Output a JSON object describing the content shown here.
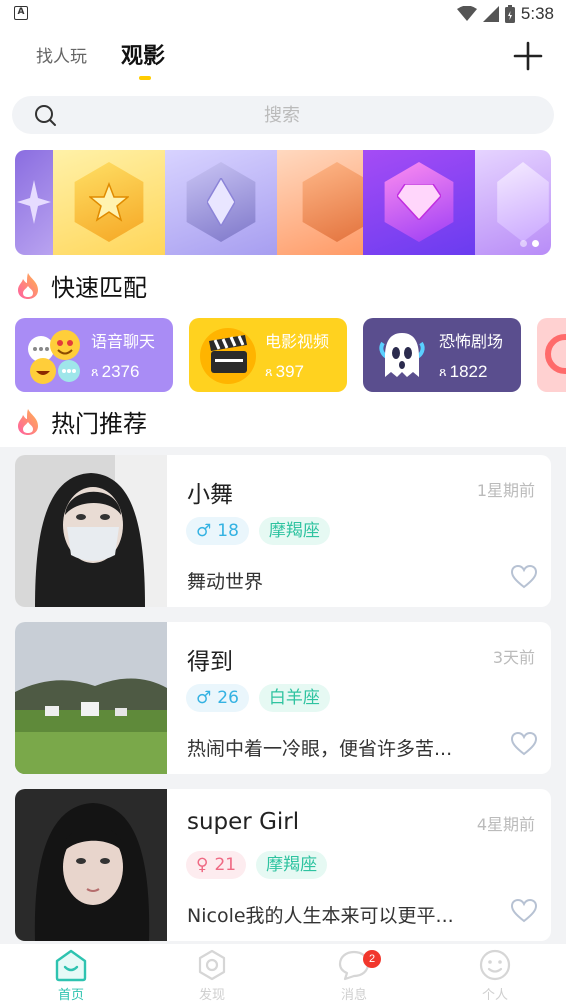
{
  "status_bar": {
    "time": "5:38",
    "left_icon": "A"
  },
  "top_tabs": {
    "find_label": "找人玩",
    "watch_label": "观影",
    "active": "观影"
  },
  "search": {
    "placeholder": "搜索"
  },
  "quick_match": {
    "title": "快速匹配",
    "items": [
      {
        "name": "语音聊天",
        "count": "2376",
        "color": "#a98cf5"
      },
      {
        "name": "电影视频",
        "count": "397",
        "color": "#ffd21f"
      },
      {
        "name": "恐怖剧场",
        "count": "1822",
        "color": "#5a4e8e"
      }
    ]
  },
  "recommend": {
    "title": "热门推荐",
    "items": [
      {
        "name": "小舞",
        "time": "1星期前",
        "gender_symbol": "♂",
        "age": "18",
        "constellation": "摩羯座",
        "signature": "舞动世界"
      },
      {
        "name": "得到",
        "time": "3天前",
        "gender_symbol": "♂",
        "age": "26",
        "constellation": "白羊座",
        "signature": "热闹中着一冷眼，便省许多苦..."
      },
      {
        "name": "super Girl",
        "time": "4星期前",
        "gender_symbol": "♀",
        "age": "21",
        "constellation": "摩羯座",
        "signature": "Nicole我的人生本来可以更平..."
      }
    ]
  },
  "bottom_nav": {
    "items": [
      {
        "label": "首页",
        "active": true
      },
      {
        "label": "发现",
        "active": false
      },
      {
        "label": "消息",
        "active": false,
        "badge": "2"
      },
      {
        "label": "个人",
        "active": false
      }
    ]
  },
  "colors": {
    "accent": "#2ec3b0",
    "tab_indicator": "#ffcc00",
    "badge": "#f1372c"
  }
}
